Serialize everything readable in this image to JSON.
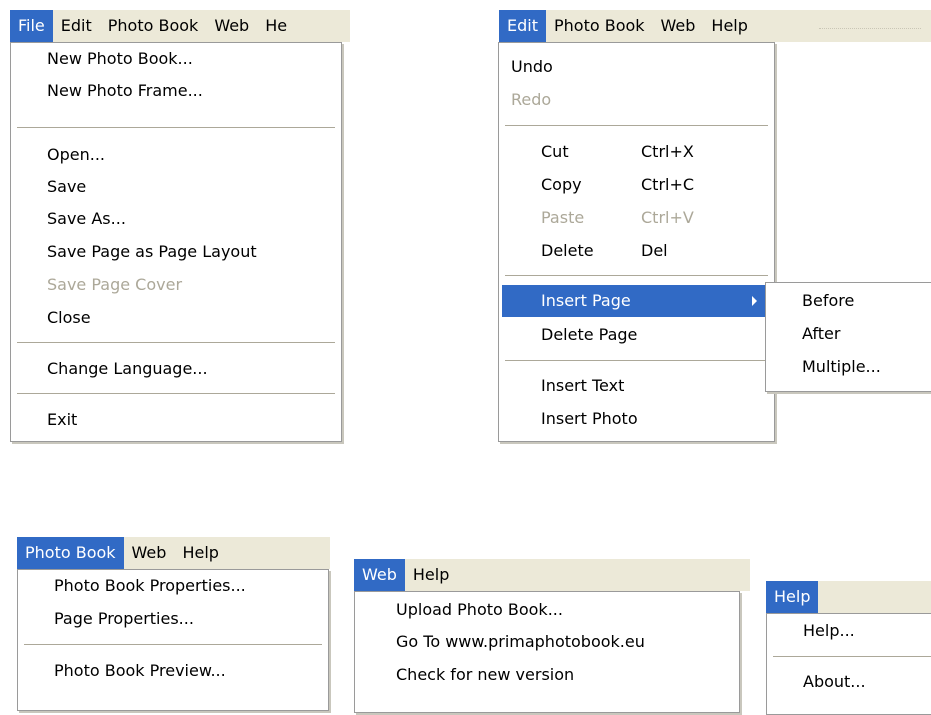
{
  "file_panel": {
    "menubar": [
      "File",
      "Edit",
      "Photo Book",
      "Web",
      "He"
    ],
    "items": {
      "new_photo_book": "New Photo Book...",
      "new_photo_frame": "New Photo Frame...",
      "open": "Open...",
      "save": "Save",
      "save_as": "Save As...",
      "save_page_layout": "Save Page as Page Layout",
      "save_page_cover": "Save Page Cover",
      "close": "Close",
      "change_language": "Change Language...",
      "exit": "Exit"
    }
  },
  "edit_panel": {
    "menubar": [
      "Edit",
      "Photo Book",
      "Web",
      "Help"
    ],
    "items": {
      "undo": "Undo",
      "redo": "Redo",
      "cut": "Cut",
      "cut_sc": "Ctrl+X",
      "copy": "Copy",
      "copy_sc": "Ctrl+C",
      "paste": "Paste",
      "paste_sc": "Ctrl+V",
      "delete": "Delete",
      "delete_sc": "Del",
      "insert_page": "Insert Page",
      "delete_page": "Delete Page",
      "insert_text": "Insert Text",
      "insert_photo": "Insert Photo"
    },
    "submenu": {
      "before": "Before",
      "after": "After",
      "multiple": "Multiple..."
    }
  },
  "photobook_panel": {
    "menubar": [
      "Photo Book",
      "Web",
      "Help"
    ],
    "items": {
      "properties": "Photo Book Properties...",
      "page_properties": "Page Properties...",
      "preview": "Photo Book Preview..."
    }
  },
  "web_panel": {
    "menubar": [
      "Web",
      "Help"
    ],
    "items": {
      "upload": "Upload Photo Book...",
      "goto": "Go To www.primaphotobook.eu",
      "check": "Check for new version"
    }
  },
  "help_panel": {
    "menubar": [
      "Help"
    ],
    "items": {
      "help": "Help...",
      "about": "About..."
    }
  },
  "colors": {
    "highlight": "#316ac5",
    "menubar_bg": "#ece9d8",
    "disabled": "#aca899"
  }
}
